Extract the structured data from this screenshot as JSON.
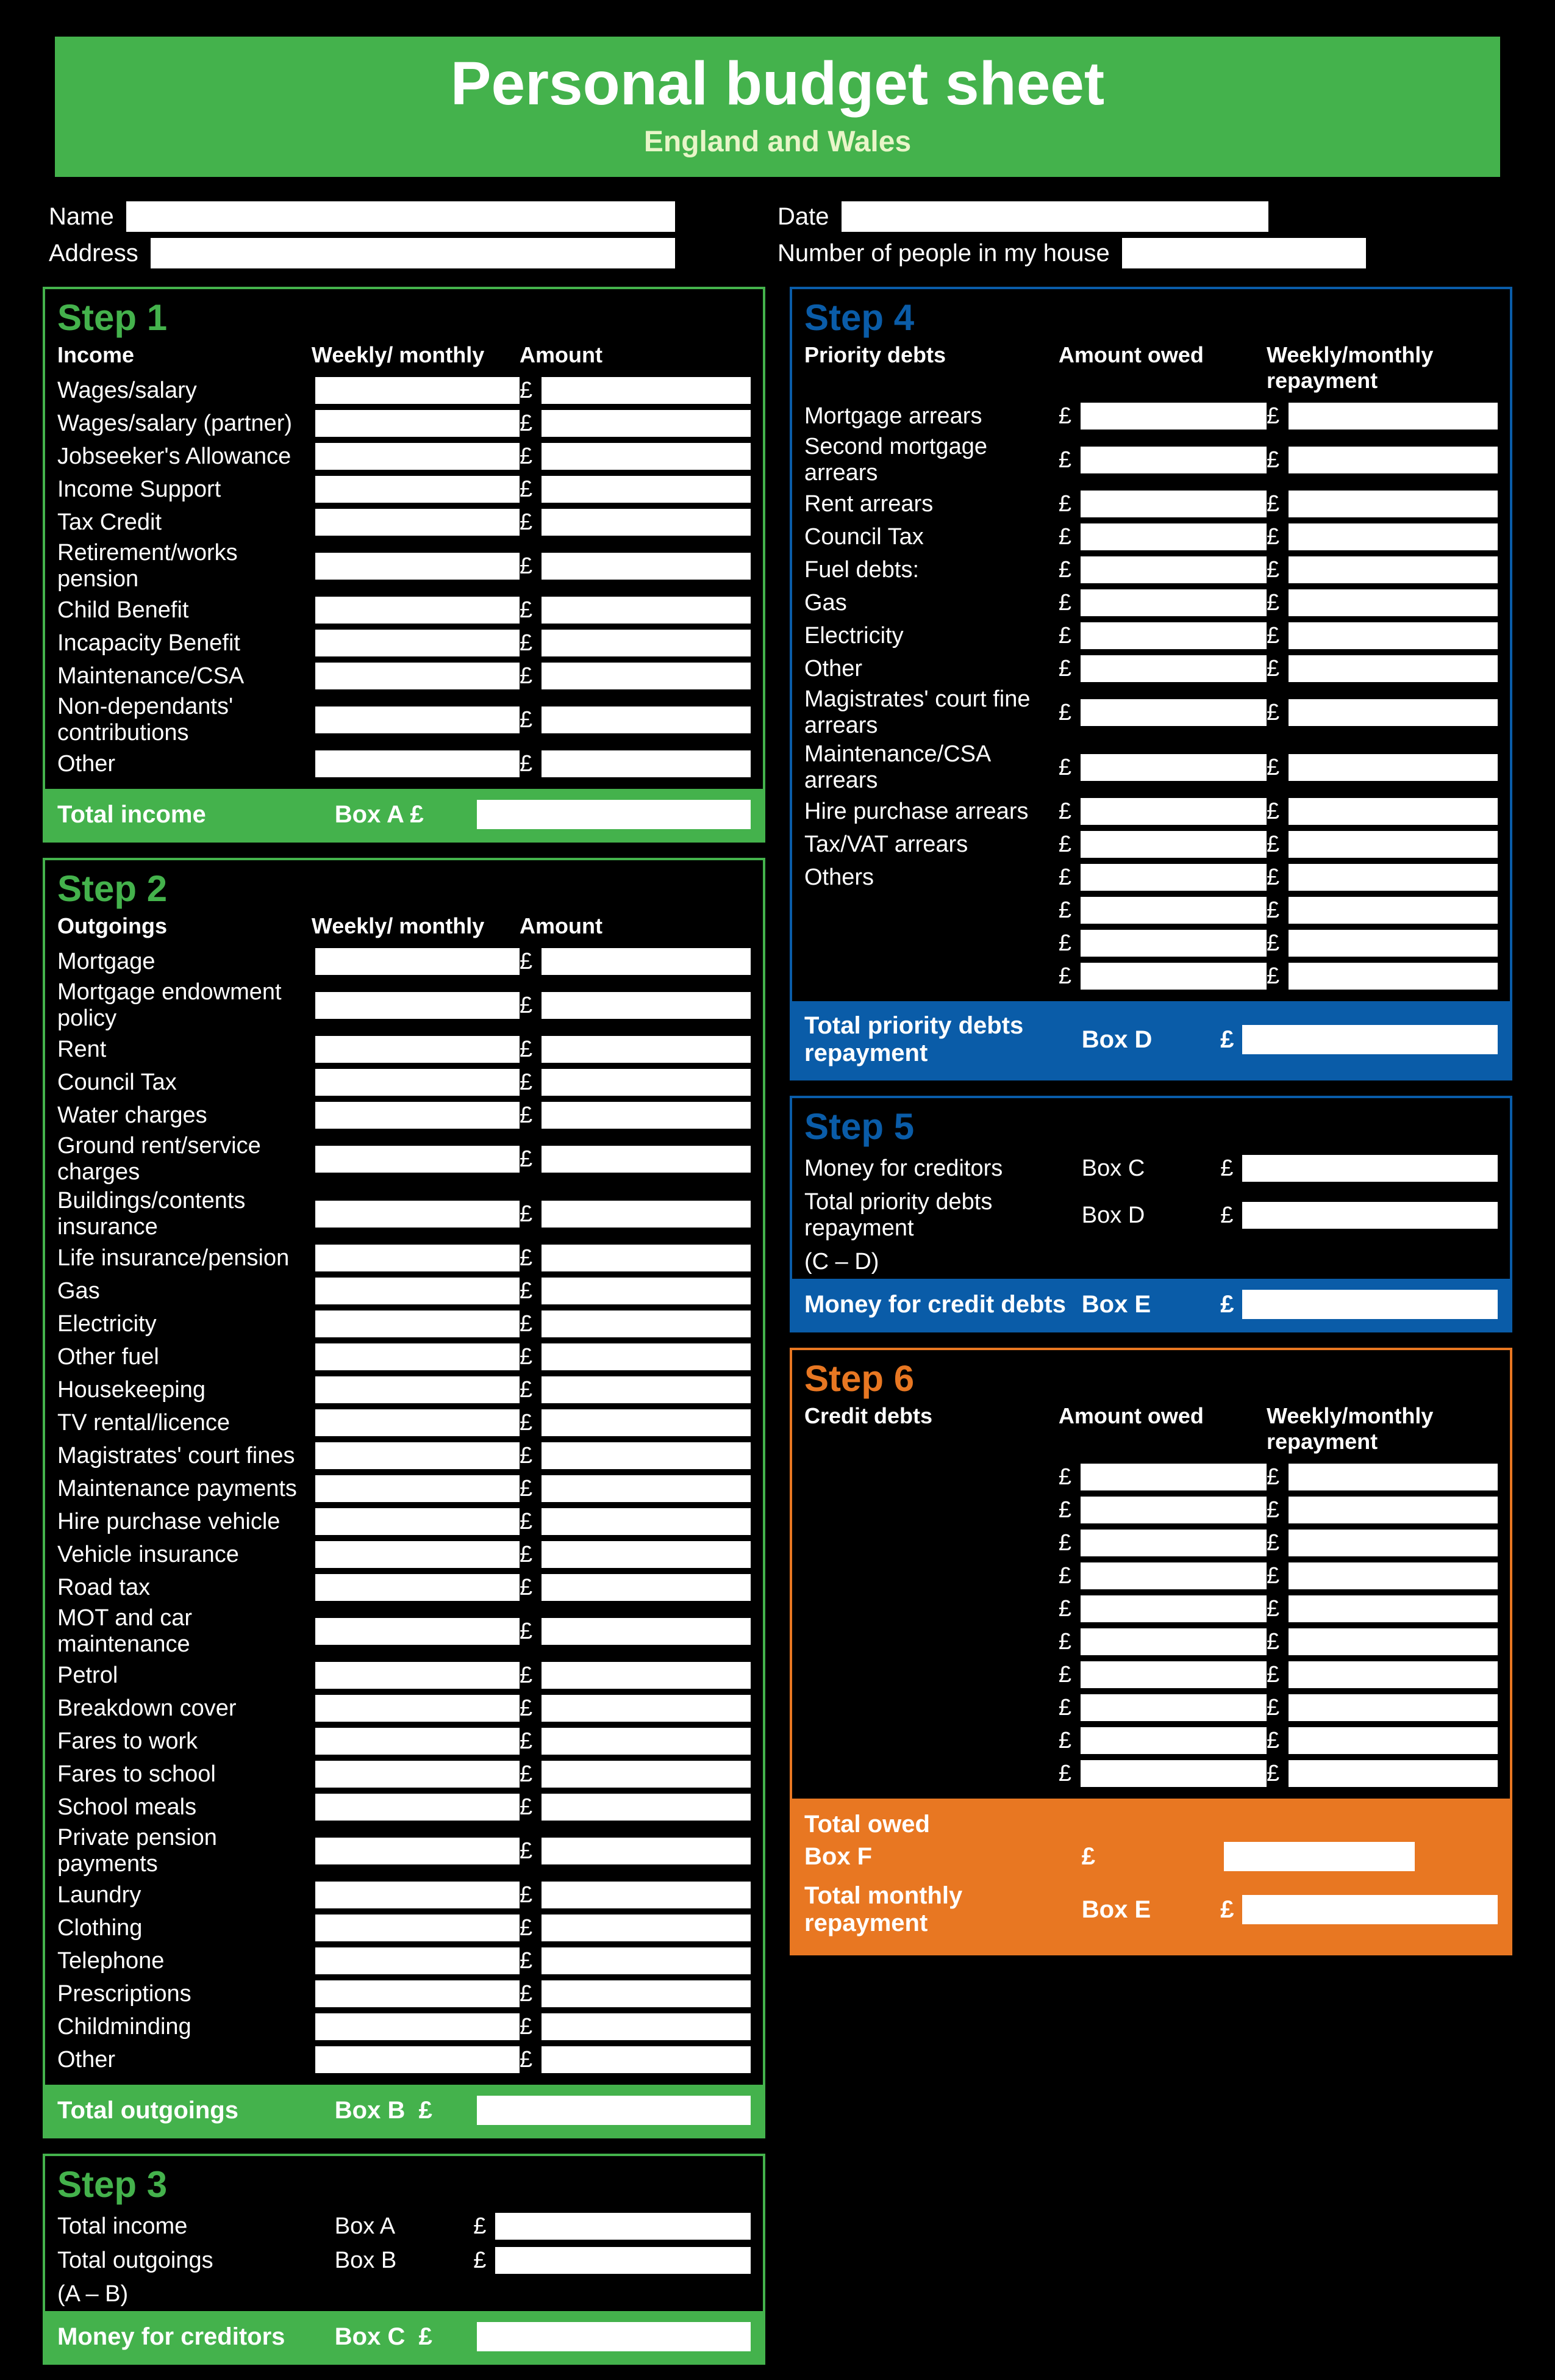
{
  "banner": {
    "title": "Personal budget sheet",
    "subtitle": "England and Wales"
  },
  "info": {
    "name_label": "Name",
    "address_label": "Address",
    "household_label": "Number of people in my house",
    "date_label": "Date"
  },
  "step1": {
    "title": "Step 1",
    "heading": "Income",
    "col_period": "Weekly/ monthly",
    "col_amount": "Amount",
    "rows": [
      "Wages/salary",
      "Wages/salary (partner)",
      "Jobseeker's Allowance",
      "Income Support",
      "Tax Credit",
      "Retirement/works pension",
      "Child Benefit",
      "Incapacity Benefit",
      "Maintenance/CSA",
      "Non-dependants' contributions",
      "Other"
    ],
    "footer_label": "Total income",
    "box_label": "Box A",
    "currency": "£"
  },
  "step2": {
    "title": "Step 2",
    "heading": "Outgoings",
    "col_period": "Weekly/ monthly",
    "col_amount": "Amount",
    "rows": [
      "Mortgage",
      "Mortgage endowment policy",
      "Rent",
      "Council Tax",
      "Water charges",
      "Ground rent/service charges",
      "Buildings/contents insurance",
      "Life insurance/pension",
      "Gas",
      "Electricity",
      "Other fuel",
      "Housekeeping",
      "TV rental/licence",
      "Magistrates' court fines",
      "Maintenance payments",
      "Hire purchase vehicle",
      "Vehicle insurance",
      "Road tax",
      "MOT and car maintenance",
      "Petrol",
      "Breakdown cover",
      "Fares to work",
      "Fares to school",
      "School meals",
      "Private pension payments",
      "Laundry",
      "Clothing",
      "Telephone",
      "Prescriptions",
      "Childminding",
      "Other"
    ],
    "footer_label": "Total outgoings",
    "box_label": "Box B",
    "currency": "£"
  },
  "step3": {
    "title": "Step 3",
    "calc_lines": [
      {
        "label": "Total income",
        "box": "Box A",
        "currency": "£"
      },
      {
        "label": "Total outgoings",
        "box": "Box B",
        "currency": "£"
      },
      {
        "label": "(A – B)",
        "box": "",
        "currency": ""
      }
    ],
    "footer_label": "Money for creditors",
    "box_label": "Box C",
    "currency": "£"
  },
  "step4": {
    "title": "Step 4",
    "heading": "Priority debts",
    "col_owed": "Amount owed",
    "col_repay": "Weekly/monthly repayment",
    "rows": [
      "Mortgage arrears",
      "Second mortgage arrears",
      "Rent arrears",
      "Council Tax",
      "Fuel debts:",
      "Gas",
      "Electricity",
      "Other",
      "Magistrates' court fine arrears",
      "Maintenance/CSA arrears",
      "Hire purchase arrears",
      "Tax/VAT arrears",
      "Others"
    ],
    "blank_rows": 3,
    "footer_label": "Total priority debts repayment",
    "box_label": "Box D",
    "currency": "£"
  },
  "step5": {
    "title": "Step 5",
    "calc_lines": [
      {
        "label": "Money for creditors",
        "box": "Box C",
        "currency": "£"
      },
      {
        "label": "Total priority debts repayment",
        "box": "Box D",
        "currency": "£"
      },
      {
        "label": "(C – D)",
        "box": "",
        "currency": ""
      }
    ],
    "footer_label": "Money for credit debts",
    "box_label": "Box E",
    "currency": "£"
  },
  "step6": {
    "title": "Step 6",
    "heading": "Credit debts",
    "col_owed": "Amount owed",
    "col_repay": "Weekly/monthly repayment",
    "blank_rows": 10,
    "footer1_label": "Total owed",
    "footer1_box": "Box F",
    "footer2_label": "Total monthly repayment",
    "footer2_box": "Box E",
    "currency": "£"
  }
}
